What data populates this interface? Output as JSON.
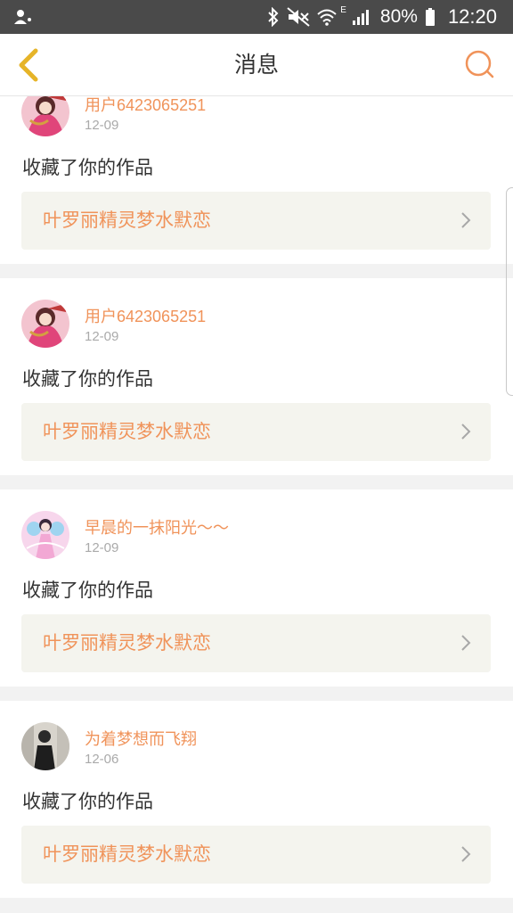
{
  "status_bar": {
    "battery_percent": "80%",
    "time": "12:20",
    "network_letter": "E",
    "icons": [
      "notification-icon",
      "bluetooth-icon",
      "mute-icon",
      "wifi-icon",
      "signal-icon",
      "battery-icon"
    ]
  },
  "header": {
    "title": "消息",
    "back_icon": "chevron-left-icon",
    "search_icon": "search-icon",
    "accent_color": "#f0935a",
    "back_color": "#e6b428"
  },
  "messages": [
    {
      "username": "用户6423065251",
      "date": "12-09",
      "action": "收藏了你的作品",
      "work_title": "叶罗丽精灵梦水默恋",
      "avatar": "avatar-pink-figure"
    },
    {
      "username": "用户6423065251",
      "date": "12-09",
      "action": "收藏了你的作品",
      "work_title": "叶罗丽精灵梦水默恋",
      "avatar": "avatar-pink-figure"
    },
    {
      "username": "早晨的一抹阳光～～",
      "date": "12-09",
      "action": "收藏了你的作品",
      "work_title": "叶罗丽精灵梦水默恋",
      "avatar": "avatar-fairy"
    },
    {
      "username": "为着梦想而飞翔",
      "date": "12-06",
      "action": "收藏了你的作品",
      "work_title": "叶罗丽精灵梦水默恋",
      "avatar": "avatar-photo-person"
    }
  ]
}
